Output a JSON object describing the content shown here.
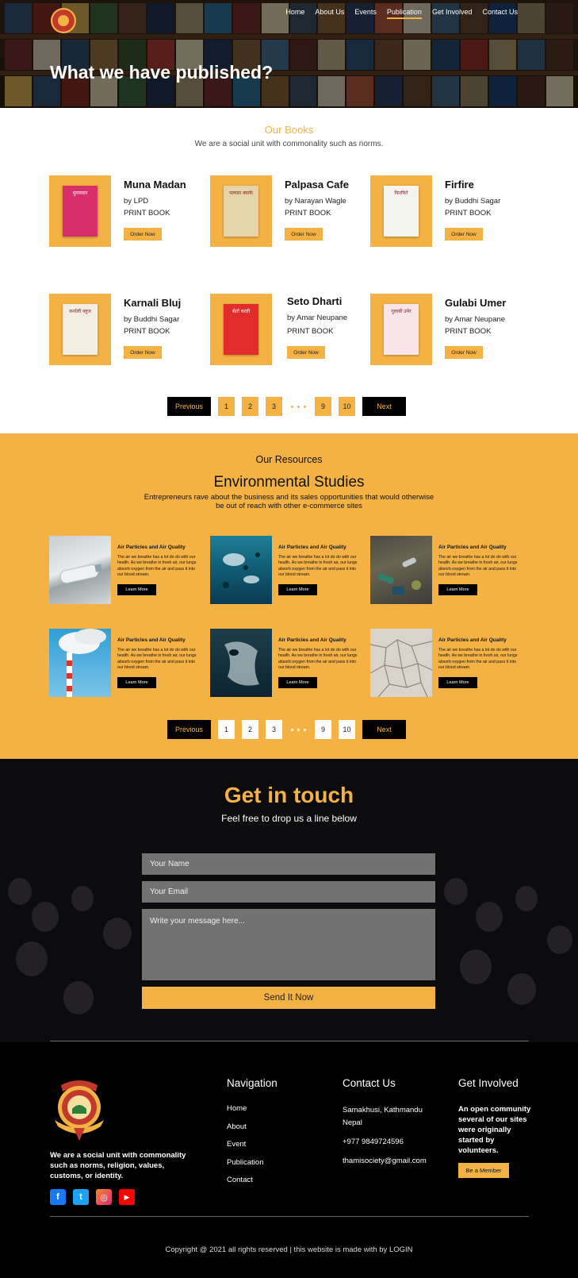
{
  "hero": {
    "title": "What we have published?",
    "nav": [
      "Home",
      "About Us",
      "Events",
      "Publication",
      "Get Involved",
      "Contact Us"
    ],
    "active_nav": "Publication"
  },
  "books_section": {
    "heading": "Our Books",
    "subheading": "We are a social unit with commonality such as norms.",
    "books": [
      {
        "title": "Muna Madan",
        "author": "by LPD",
        "type": "PRINT BOOK",
        "button": "Order Now",
        "cover_color": "#d62f6a",
        "cover_text": "मुनामदन"
      },
      {
        "title": "Palpasa Cafe",
        "author": "by Narayan Wagle",
        "type": "PRINT BOOK",
        "button": "Order Now",
        "cover_color": "#e7d3a8",
        "cover_text": "पल्पसा क्याफे"
      },
      {
        "title": "Firfire",
        "author": "by Buddhi Sagar",
        "type": "PRINT BOOK",
        "button": "Order Now",
        "cover_color": "#f5f5f0",
        "cover_text": "फिरफिरे"
      },
      {
        "title": "Karnali Bluj",
        "author": "by Buddhi Sagar",
        "type": "PRINT BOOK",
        "button": "Order Now",
        "cover_color": "#f3eee2",
        "cover_text": "कर्नाली ब्लुज"
      },
      {
        "title": "Seto Dharti",
        "author": "by Amar Neupane",
        "type": "PRINT BOOK",
        "button": "Order Now",
        "cover_color": "#e22b2b",
        "cover_text": "सेतो धरती"
      },
      {
        "title": "Gulabi Umer",
        "author": "by Amar Neupane",
        "type": "PRINT BOOK",
        "button": "Order Now",
        "cover_color": "#f7e5ea",
        "cover_text": "गुलाबी उमेर"
      }
    ],
    "pagination": {
      "prev": "Previous",
      "pages": [
        "1",
        "2",
        "3",
        "9",
        "10"
      ],
      "next": "Next"
    }
  },
  "resources": {
    "heading": "Our Resources",
    "title": "Environmental Studies",
    "subtitle": "Entrepreneurs rave about the business and its sales opportunities that would otherwise be out of reach with other e-commerce sites",
    "cards": [
      {
        "title": "Air Particles and Air Quality",
        "text": "The air we breathe has a lot do do with our health. As we breathe in fresh air, our lungs absorb oxygen from the air and pass it into our blood stream.",
        "button": "Learn More",
        "image": "plastic-bottle"
      },
      {
        "title": "Air Particles and Air Quality",
        "text": "The air we breathe has a lot do do with our health. As we breathe in fresh air, our lungs absorb oxygen from the air and pass it into our blood stream.",
        "button": "Learn More",
        "image": "ocean-plastic"
      },
      {
        "title": "Air Particles and Air Quality",
        "text": "The air we breathe has a lot do do with our health. As we breathe in fresh air, our lungs absorb oxygen from the air and pass it into our blood stream.",
        "button": "Learn More",
        "image": "waste-pile"
      },
      {
        "title": "Air Particles and Air Quality",
        "text": "The air we breathe has a lot do do with our health. As we breathe in fresh air, our lungs absorb oxygen from the air and pass it into our blood stream.",
        "button": "Learn More",
        "image": "smokestack"
      },
      {
        "title": "Air Particles and Air Quality",
        "text": "The air we breathe has a lot do do with our health. As we breathe in fresh air, our lungs absorb oxygen from the air and pass it into our blood stream.",
        "button": "Learn More",
        "image": "underwater-bag"
      },
      {
        "title": "Air Particles and Air Quality",
        "text": "The air we breathe has a lot do do with our health. As we breathe in fresh air, our lungs absorb oxygen from the air and pass it into our blood stream.",
        "button": "Learn More",
        "image": "cracked-earth"
      }
    ],
    "pagination": {
      "prev": "Previous",
      "pages": [
        "1",
        "2",
        "3",
        "9",
        "10"
      ],
      "next": "Next"
    }
  },
  "contact": {
    "title": "Get in touch",
    "subtitle": "Feel free to drop us a line below",
    "name_placeholder": "Your Name",
    "email_placeholder": "Your Email",
    "message_placeholder": "Write your message here...",
    "submit": "Send It Now"
  },
  "footer": {
    "about": "We are a social unit with commonality such as norms, religion, values, customs, or identity.",
    "navigation_title": "Navigation",
    "navigation": [
      "Home",
      "About",
      "Event",
      "Publication",
      "Contact"
    ],
    "contact_title": "Contact Us",
    "address": "Samakhusi, Kathmandu Nepal",
    "phone": "+977 9849724596",
    "email": "thamisociety@gmail.com",
    "get_involved_title": "Get Involved",
    "get_involved_text": "An open community several of our sites were originally started by volunteers.",
    "member_button": "Be a Member",
    "copyright": "Copyright @ 2021 all rights reserved | this website is made with by LOGIN",
    "socials": [
      {
        "name": "facebook-icon",
        "glyph": "f",
        "color": "#1877f2"
      },
      {
        "name": "twitter-icon",
        "glyph": "t",
        "color": "#1da1f2"
      },
      {
        "name": "instagram-icon",
        "glyph": "◎",
        "color": "#e1306c"
      },
      {
        "name": "youtube-icon",
        "glyph": "▶",
        "color": "#ff0000"
      }
    ]
  },
  "colors": {
    "accent": "#f4b245",
    "dark": "#000000"
  }
}
